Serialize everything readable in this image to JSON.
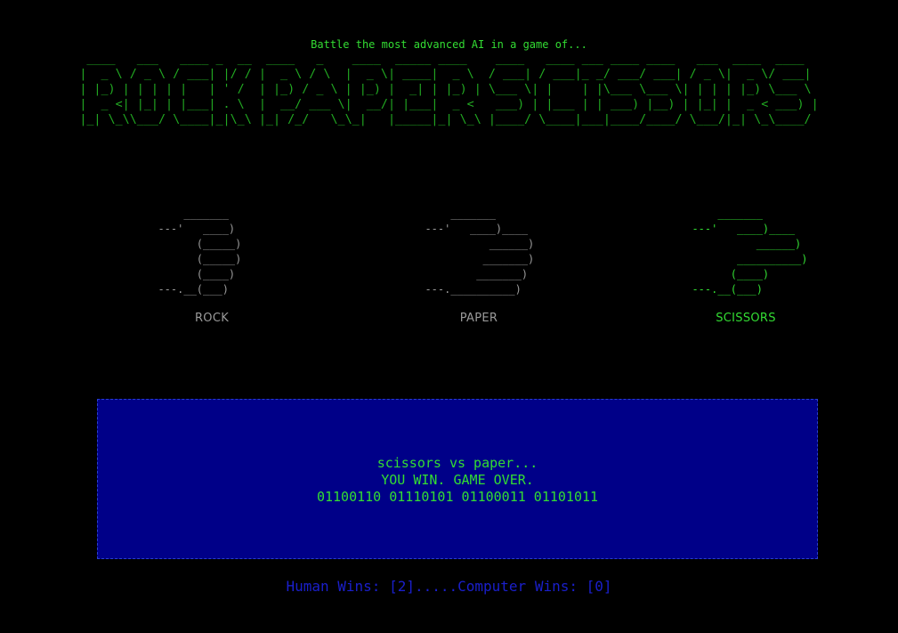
{
  "tagline": "Battle the most advanced AI in a game of...",
  "banner": {
    "title": "ROCK PAPER SCISSORS",
    "art": " ____   ___   ____ _  __  ____   _    ____  _____ ____    ____   ____ ___ ____ ____   ___  ____  ____  \n|  _ \\ / _ \\ / ___| |/ / |  _ \\ / \\  |  _ \\| ____|  _ \\  / ___| / ___|_ _/ ___/ ___| / _ \\|  _ \\/ ___| \n| |_) | | | | |   | ' /  | |_) / _ \\ | |_) |  _| | |_) | \\___ \\| |    | |\\___ \\___ \\| | | | |_) \\___ \\ \n|  _ <| |_| | |___| . \\  |  __/ ___ \\|  __/| |___|  _ <   ___) | |___ | | ___) |__) | |_| |  _ < ___) |\n|_| \\_\\\\___/ \\____|_|\\_\\ |_| /_/   \\_\\_|   |_____|_| \\_\\ |____/ \\____|___|____/____/ \\___/|_| \\_\\____/ "
  },
  "choices": [
    {
      "id": "rock",
      "label": "ROCK",
      "state": "dim",
      "art": "      _______\n  ---'   ____)\n        (_____)\n        (_____)\n        (____)\n  ---.__(___)"
    },
    {
      "id": "paper",
      "label": "PAPER",
      "state": "dim",
      "art": "      _______\n  ---'   ____)____\n            ______)\n           _______)\n          _______)\n  ---.__________)"
    },
    {
      "id": "scissors",
      "label": "SCISSORS",
      "state": "active",
      "art": "      _______\n  ---'   ____)____\n            ______)\n         __________)\n        (____)\n  ---.__(___)"
    }
  ],
  "result": {
    "matchup": "scissors vs paper...",
    "outcome": "YOU WIN. GAME OVER.",
    "binary": "01100110 01110101 01100011 01101011"
  },
  "score": {
    "text": "Human Wins: [2].....Computer Wins: [0]"
  },
  "colors": {
    "background": "#000000",
    "accent_green": "#33dd33",
    "dim_gray": "#9a9a9a",
    "panel_blue": "#000088",
    "score_blue": "#1a1fcc"
  }
}
